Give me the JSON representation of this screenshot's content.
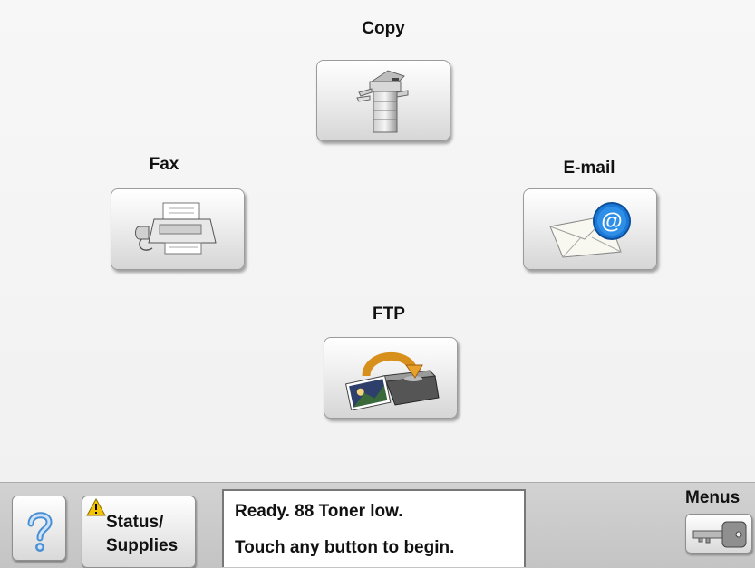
{
  "home": {
    "copy_label": "Copy",
    "fax_label": "Fax",
    "email_label": "E-mail",
    "ftp_label": "FTP"
  },
  "bottom_bar": {
    "help_icon": "question-mark-icon",
    "status_supplies_line1": "Status/",
    "status_supplies_line2": "Supplies",
    "warning_icon": "warning-triangle-icon",
    "message_line1": "Ready. 88 Toner low.",
    "message_line2": "Touch any button to begin.",
    "menus_label": "Menus",
    "menus_icon": "key-icon"
  },
  "colors": {
    "help_blue": "#4a8fd3",
    "warning_yellow": "#f5c400",
    "email_badge_blue": "#1c78d6"
  }
}
